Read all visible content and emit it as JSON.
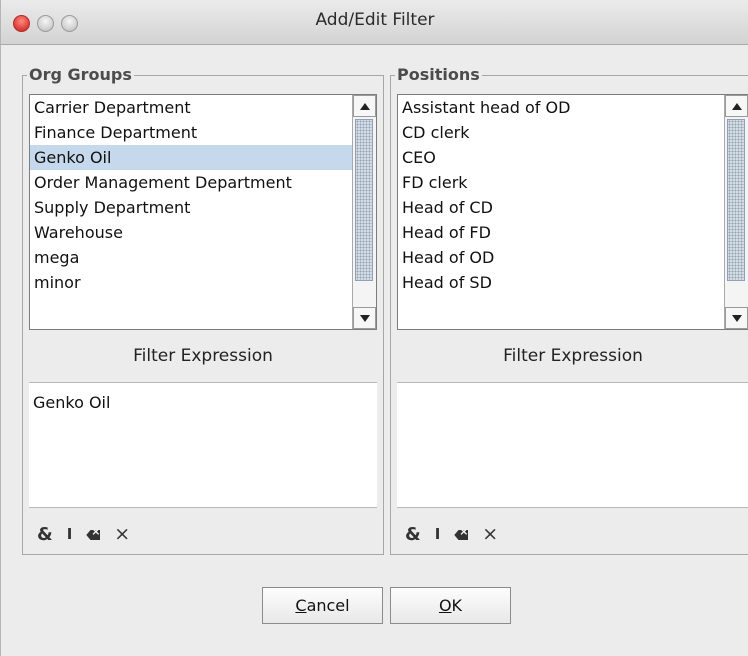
{
  "window": {
    "title": "Add/Edit Filter"
  },
  "org_groups": {
    "label": "Org Groups",
    "items": [
      {
        "label": "Carrier Department",
        "selected": false
      },
      {
        "label": "Finance Department",
        "selected": false
      },
      {
        "label": "Genko Oil",
        "selected": true
      },
      {
        "label": "Order Management Department",
        "selected": false
      },
      {
        "label": "Supply Department",
        "selected": false
      },
      {
        "label": "Warehouse",
        "selected": false
      },
      {
        "label": "mega",
        "selected": false
      },
      {
        "label": "minor",
        "selected": false
      }
    ],
    "filter_header": "Filter Expression",
    "filter_value": "Genko Oil",
    "tools": [
      "&",
      "I",
      "backspace-icon",
      "×"
    ]
  },
  "positions": {
    "label": "Positions",
    "items": [
      {
        "label": "Assistant head of OD",
        "selected": false
      },
      {
        "label": "CD clerk",
        "selected": false
      },
      {
        "label": "CEO",
        "selected": false
      },
      {
        "label": "FD clerk",
        "selected": false
      },
      {
        "label": "Head of CD",
        "selected": false
      },
      {
        "label": "Head of FD",
        "selected": false
      },
      {
        "label": "Head of OD",
        "selected": false
      },
      {
        "label": "Head of SD",
        "selected": false
      }
    ],
    "filter_header": "Filter Expression",
    "filter_value": "",
    "tools": [
      "&",
      "I",
      "backspace-icon",
      "×"
    ]
  },
  "buttons": {
    "cancel_mnemonic": "C",
    "cancel_rest": "ancel",
    "ok_mnemonic": "O",
    "ok_rest": "K"
  },
  "colors": {
    "selection": "#c5d8ec",
    "window_bg": "#ececec",
    "close_button": "#e0443e"
  }
}
